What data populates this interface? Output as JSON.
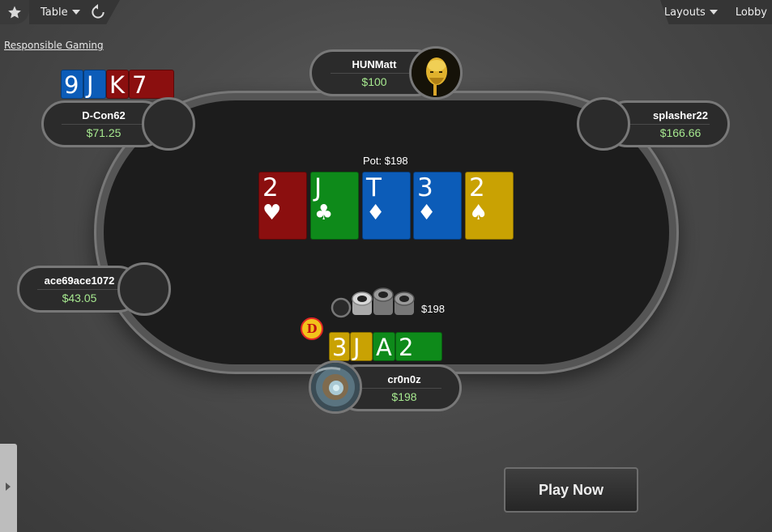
{
  "toolbar": {
    "favorite_icon": "star-icon",
    "table_menu": "Table",
    "reload_icon": "reload-icon",
    "layouts_menu": "Layouts",
    "lobby_link": "Lobby"
  },
  "responsible_gaming": "Responsible Gaming",
  "pot": "Pot: $198",
  "players": {
    "top": {
      "name": "HUNMatt",
      "stack": "$100",
      "avatar": "portrait-avatar"
    },
    "top_left": {
      "name": "D-Con62",
      "stack": "$71.25"
    },
    "top_right": {
      "name": "splasher22",
      "stack": "$166.66"
    },
    "left": {
      "name": "ace69ace1072",
      "stack": "$43.05"
    },
    "hero": {
      "name": "cr0n0z",
      "stack": "$198",
      "avatar": "landscape-avatar"
    }
  },
  "opponent_cards": {
    "top_left": [
      {
        "rank": "9",
        "color": "blue"
      },
      {
        "rank": "J",
        "color": "blue"
      },
      {
        "rank": "K",
        "color": "red"
      },
      {
        "rank": "7",
        "color": "red"
      }
    ]
  },
  "board": [
    {
      "rank": "2",
      "suit": "♥",
      "color": "red"
    },
    {
      "rank": "J",
      "suit": "♣",
      "color": "green"
    },
    {
      "rank": "T",
      "suit": "♦",
      "color": "blue"
    },
    {
      "rank": "3",
      "suit": "♦",
      "color": "blue"
    },
    {
      "rank": "2",
      "suit": "♠",
      "color": "gold"
    }
  ],
  "hero_cards": [
    {
      "rank": "3",
      "color": "gold"
    },
    {
      "rank": "J",
      "color": "gold"
    },
    {
      "rank": "A",
      "color": "green"
    },
    {
      "rank": "2",
      "color": "green"
    }
  ],
  "hero_bet": "$198",
  "dealer_button": "D",
  "play_now": "Play Now",
  "colors": {
    "red": "#8b0f0f",
    "green": "#0e8a1a",
    "blue": "#0c5cb8",
    "gold": "#c9a203",
    "stack_text": "#a6e88f"
  }
}
